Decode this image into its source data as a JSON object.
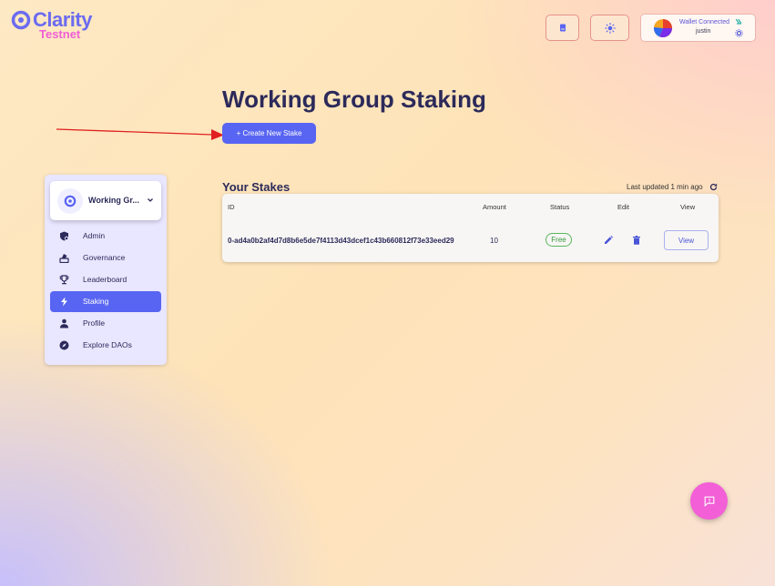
{
  "logo": {
    "name": "Clarity",
    "subtitle": "Testnet"
  },
  "header": {
    "docs_icon": "book-icon",
    "theme_icon": "sun-icon",
    "wallet": {
      "status": "Wallet Connected",
      "user": "justin"
    }
  },
  "page": {
    "title": "Working Group Staking",
    "create_button": "+ Create New Stake"
  },
  "sidebar": {
    "group_name": "Working Gr...",
    "items": [
      {
        "label": "Admin",
        "icon": "admin-icon",
        "active": false
      },
      {
        "label": "Governance",
        "icon": "governance-icon",
        "active": false
      },
      {
        "label": "Leaderboard",
        "icon": "trophy-icon",
        "active": false
      },
      {
        "label": "Staking",
        "icon": "bolt-icon",
        "active": true
      },
      {
        "label": "Profile",
        "icon": "person-icon",
        "active": false
      },
      {
        "label": "Explore DAOs",
        "icon": "compass-icon",
        "active": false
      }
    ]
  },
  "stakes": {
    "title": "Your Stakes",
    "last_updated": "Last updated 1 min ago",
    "columns": {
      "id": "ID",
      "amount": "Amount",
      "status": "Status",
      "edit": "Edit",
      "view": "View"
    },
    "rows": [
      {
        "id": "0-ad4a0b2af4d7d8b6e5de7f4113d43dcef1c43b660812f73e33eed29",
        "amount": "10",
        "status": "Free",
        "view_label": "View"
      }
    ]
  },
  "colors": {
    "primary": "#5865f2",
    "accent": "#f25fd6",
    "title": "#2c2a5a",
    "free": "#58b85e",
    "arrow": "#e02020"
  }
}
